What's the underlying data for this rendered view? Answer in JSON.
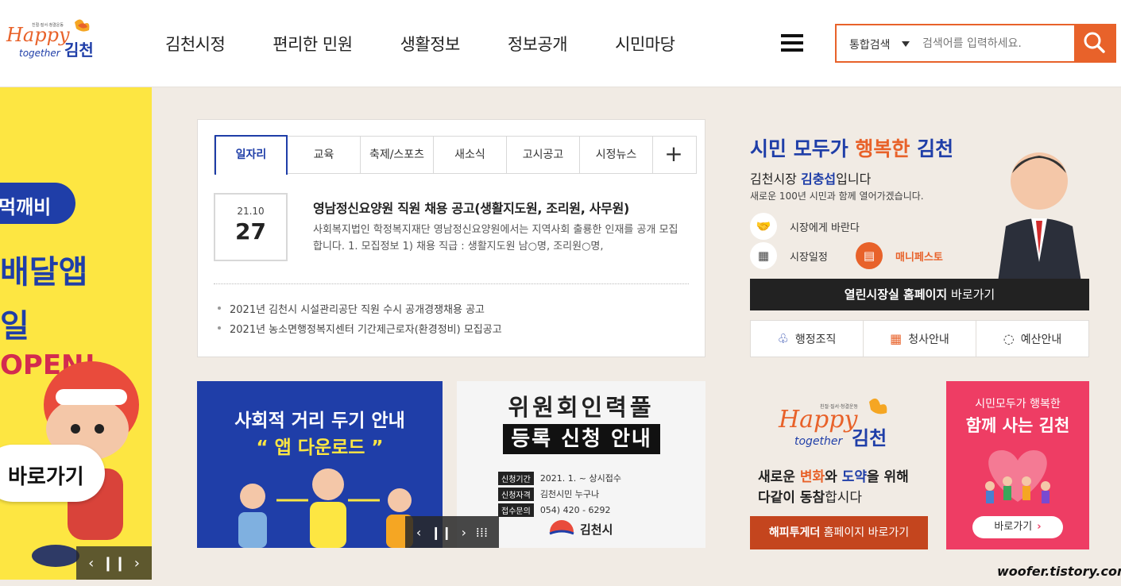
{
  "header": {
    "logo": {
      "script": "Happy",
      "sub": "together",
      "name": "김천",
      "tagline": "친절·질서·청결운동"
    },
    "nav": [
      "김천시정",
      "편리한 민원",
      "생활정보",
      "정보공개",
      "시민마당"
    ],
    "search": {
      "category": "통합검색",
      "placeholder": "검색어를 입력하세요."
    }
  },
  "left_banner": {
    "pill": "먹깨비",
    "line1": "배달앱",
    "line2": "일",
    "open": "OPEN!",
    "go": "바로가기"
  },
  "news": {
    "tabs": [
      "일자리",
      "교육",
      "축제/스포츠",
      "새소식",
      "고시공고",
      "시정뉴스"
    ],
    "active_tab": "일자리",
    "more": "+",
    "featured": {
      "date_ym": "21.10",
      "date_d": "27",
      "title": "영남정신요양원 직원 채용 공고(생활지도원, 조리원, 사무원)",
      "summary": "사회복지법인 학정복지재단 영남정신요양원에서는 지역사회 출룡한 인재를 공개 모집합니다.   1. 모집정보 1) 채용 직급 : 생활지도원 남○명, 조리원○명,"
    },
    "items": [
      "2021년 김천시 시설관리공단 직원 수시 공개경쟁채용 공고",
      "2021년 농소면행정복지센터 기간제근로자(환경정비) 모집공고"
    ]
  },
  "promo1": {
    "line1": "사회적 거리 두기 안내",
    "line2": "“ 앱 다운로드 ”"
  },
  "promo2": {
    "line1": "위원회인력풀",
    "line2": "등록 신청 안내",
    "info": [
      {
        "label": "신청기간",
        "value": "2021. 1. ~ 상시접수"
      },
      {
        "label": "신청자격",
        "value": "김천시민 누구나"
      },
      {
        "label": "접수문의",
        "value": "054) 420 - 6292"
      }
    ],
    "city": "김천시"
  },
  "mayor": {
    "slogan_a": "시민 모두가 ",
    "slogan_b": "행복한",
    "slogan_c": " 김천",
    "name_prefix": "김천시장 ",
    "name": "김충섭",
    "name_suffix": "입니다",
    "sub": "새로운 100년 시민과 함께 열어가겠습니다.",
    "links": {
      "request": "시장에게 바란다",
      "schedule": "시장일정",
      "manifesto": "매니페스토"
    },
    "bar_bold": "열린시장실 홈페이지",
    "bar_rest": " 바로가기",
    "bottom": [
      "행정조직",
      "청사안내",
      "예산안내"
    ]
  },
  "happy": {
    "l1a": "새로운 ",
    "l1b": "변화",
    "l1c": "와 ",
    "l1d": "도약",
    "l1e": "을 위해",
    "l2a": "다같이 동참",
    "l2b": "합시다",
    "btn_bold": "해피투게더",
    "btn_rest": " 홈페이지 바로가기"
  },
  "pink": {
    "line1": "시민모두가 행복한",
    "line2": "함께 사는 김천",
    "btn": "바로가기"
  },
  "watermark": "woofer.tistory.com",
  "colors": {
    "orange": "#e8622a",
    "navy": "#1f3ea8",
    "yellow": "#fde642",
    "pink": "#ee3d64",
    "beige": "#f1ebe4"
  }
}
